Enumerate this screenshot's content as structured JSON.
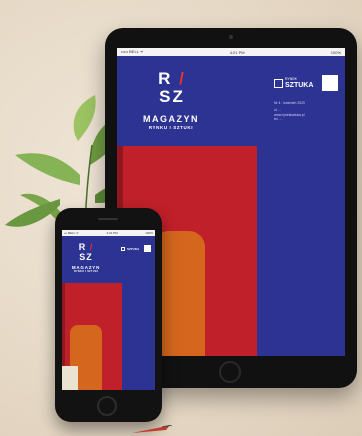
{
  "tablet": {
    "status": {
      "carrier": "••••• BELL ᯤ",
      "time": "4:21 PM",
      "battery": "100%"
    },
    "logo": {
      "top_line": "R",
      "slash": "/",
      "bottom_left": "S",
      "bottom_right": "Z"
    },
    "magazine": {
      "title": "MAGAZYN",
      "subtitle": "RYNKU I SZTUKI"
    },
    "brand": {
      "small": "RYNEK",
      "name": "SZTUKA"
    },
    "info": {
      "issue": "Nr 4 · kwiecień 2020",
      "address": "ul. ...",
      "website": "www.rynekisztuka.pl",
      "contact": "tel. ..."
    }
  },
  "phone": {
    "status": {
      "carrier": "••• BELL ᯤ",
      "time": "4:21 PM",
      "battery": "100%"
    },
    "logo": {
      "top_line": "R",
      "slash": "/",
      "bottom_left": "S",
      "bottom_right": "Z"
    },
    "magazine": {
      "title": "MAGAZYN",
      "subtitle": "RYNKU I SZTUKI"
    },
    "brand": {
      "name": "SZTUKA"
    }
  },
  "colors": {
    "cover_blue": "#2c3393",
    "art_red": "#c0202a",
    "art_orange": "#d4661d",
    "logo_slash_red": "#e8342c"
  }
}
